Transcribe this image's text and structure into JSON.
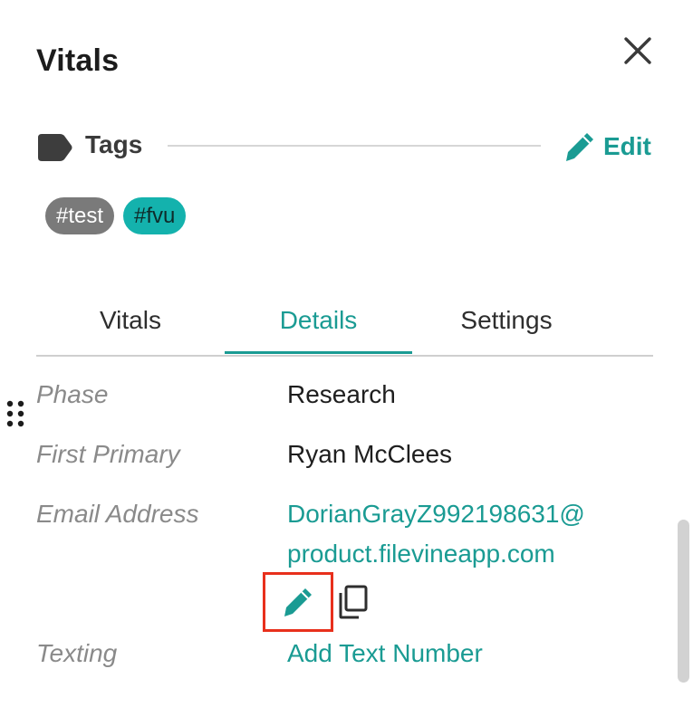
{
  "header": {
    "title": "Vitals",
    "close_icon": "close-icon"
  },
  "tags": {
    "label": "Tags",
    "icon": "tag-icon",
    "edit_label": "Edit",
    "edit_icon": "pencil-icon",
    "chips": [
      {
        "label": "#test",
        "color": "#7a7a7a"
      },
      {
        "label": "#fvu",
        "color": "#14b2ad"
      }
    ]
  },
  "tabs": [
    {
      "label": "Vitals",
      "active": false
    },
    {
      "label": "Details",
      "active": true
    },
    {
      "label": "Settings",
      "active": false
    }
  ],
  "details": {
    "rows": [
      {
        "label": "Phase",
        "value": "Research"
      },
      {
        "label": "First Primary",
        "value": "Ryan McClees"
      },
      {
        "label": "Email Address",
        "value_line1": "DorianGrayZ992198631@",
        "value_line2": "product.filevineapp.com"
      },
      {
        "label": "Texting",
        "value": "Add Text Number"
      }
    ],
    "email_actions": {
      "edit_icon": "pencil-icon",
      "copy_icon": "copy-icon"
    }
  },
  "colors": {
    "accent": "#1a9b93",
    "highlight_box": "#e8301c",
    "label_gray": "#8a8a8a"
  }
}
